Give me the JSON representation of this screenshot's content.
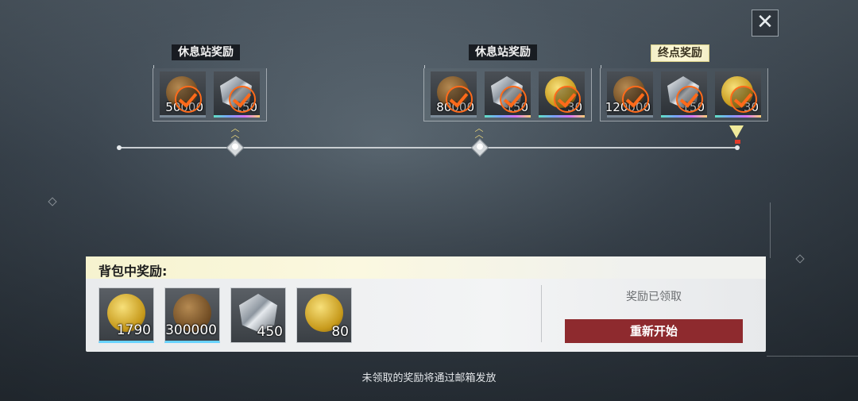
{
  "header": {
    "close_icon": "close-icon",
    "close_glyph": "✕"
  },
  "stops": [
    {
      "label": "休息站奖励",
      "final": false,
      "rewards": [
        {
          "icon": "bronze-coin-icon",
          "qty": "50000",
          "claimed": true
        },
        {
          "icon": "crystal-icon",
          "qty": "150",
          "claimed": true
        }
      ]
    },
    {
      "label": "休息站奖励",
      "final": false,
      "rewards": [
        {
          "icon": "bronze-coin-icon",
          "qty": "80000",
          "claimed": true
        },
        {
          "icon": "crystal-icon",
          "qty": "150",
          "claimed": true
        },
        {
          "icon": "gold-note-coin-icon",
          "qty": "30",
          "claimed": true
        }
      ]
    },
    {
      "label": "终点奖励",
      "final": true,
      "rewards": [
        {
          "icon": "bronze-coin-icon",
          "qty": "120000",
          "claimed": true
        },
        {
          "icon": "crystal-icon",
          "qty": "150",
          "claimed": true
        },
        {
          "icon": "gold-note-coin-icon",
          "qty": "30",
          "claimed": true
        }
      ]
    }
  ],
  "bag": {
    "title": "背包中奖励:",
    "items": [
      {
        "icon": "gold-token-icon",
        "qty": "1790"
      },
      {
        "icon": "bronze-coin-icon",
        "qty": "300000"
      },
      {
        "icon": "crystal-icon",
        "qty": "450"
      },
      {
        "icon": "gold-note-coin-icon",
        "qty": "80"
      }
    ],
    "status": "奖励已领取",
    "restart_label": "重新开始"
  },
  "footer_note": "未领取的奖励将通过邮箱发放",
  "colors": {
    "accent_check": "#ff6a1a",
    "restart_button": "#8e2a2e",
    "final_label_bg": "#fff9d6"
  }
}
